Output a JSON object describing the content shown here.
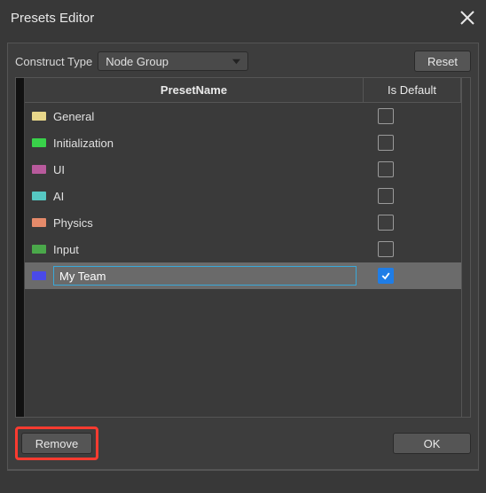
{
  "window": {
    "title": "Presets Editor"
  },
  "toolbar": {
    "construct_type_label": "Construct Type",
    "construct_type_value": "Node Group",
    "reset_label": "Reset"
  },
  "table": {
    "headers": {
      "name": "PresetName",
      "is_default": "Is Default"
    },
    "rows": [
      {
        "label": "General",
        "color": "#e8d78a",
        "is_default": false,
        "selected": false,
        "editing": false
      },
      {
        "label": "Initialization",
        "color": "#39d24a",
        "is_default": false,
        "selected": false,
        "editing": false
      },
      {
        "label": "UI",
        "color": "#b85a9c",
        "is_default": false,
        "selected": false,
        "editing": false
      },
      {
        "label": "AI",
        "color": "#56c7c2",
        "is_default": false,
        "selected": false,
        "editing": false
      },
      {
        "label": "Physics",
        "color": "#e58a6a",
        "is_default": false,
        "selected": false,
        "editing": false
      },
      {
        "label": "Input",
        "color": "#4aa84a",
        "is_default": false,
        "selected": false,
        "editing": false
      },
      {
        "label": "My Team",
        "color": "#4a4ae8",
        "is_default": true,
        "selected": true,
        "editing": true
      }
    ]
  },
  "footer": {
    "remove_label": "Remove",
    "ok_label": "OK"
  }
}
